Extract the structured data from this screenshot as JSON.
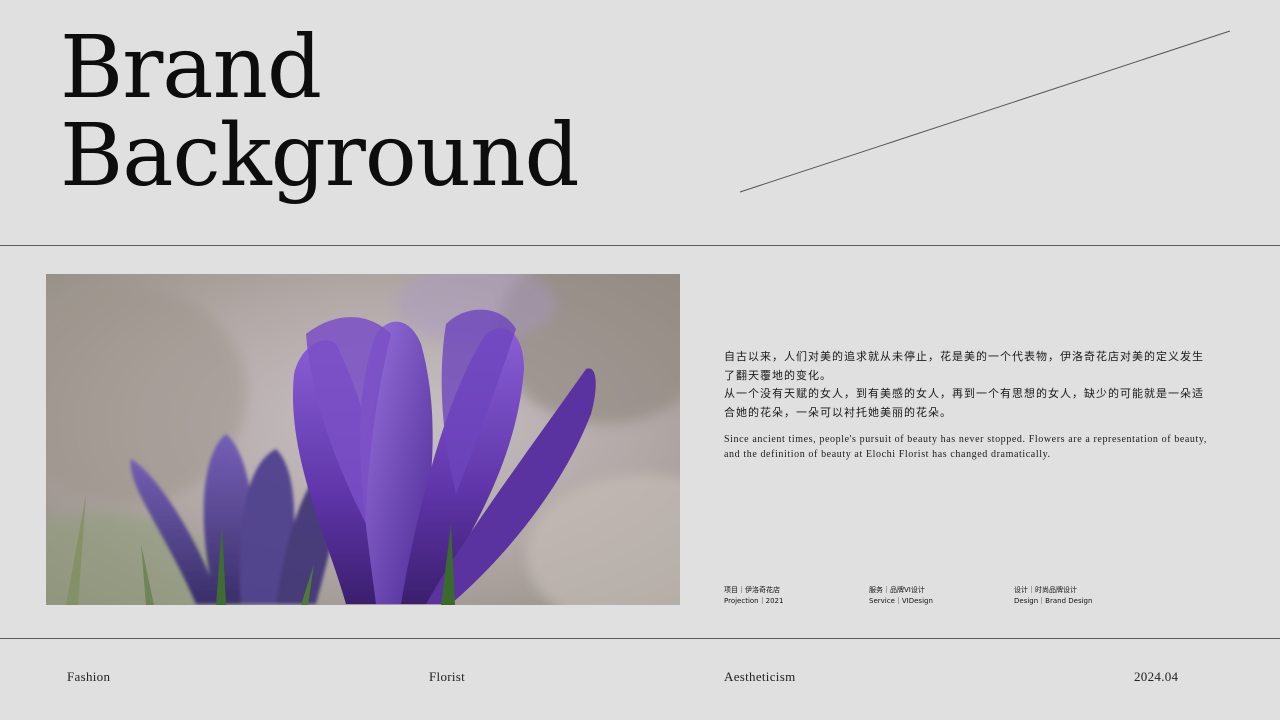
{
  "title": {
    "line1": "Brand",
    "line2": "Background"
  },
  "description": {
    "cn_para1": "自古以来，人们对美的追求就从未停止，花是美的一个代表物，伊洛奇花店对美的定义发生了翻天覆地的变化。",
    "cn_para2": "从一个没有天赋的女人，到有美感的女人，再到一个有思想的女人，缺少的可能就是一朵适合她的花朵，一朵可以衬托她美丽的花朵。",
    "en": "Since ancient times, people's pursuit of beauty has never stopped. Flowers are a representation of beauty, and the definition of beauty at Elochi Florist has changed dramatically."
  },
  "meta": [
    {
      "cn": "项目｜伊洛奇花店",
      "en": "Projection｜2021"
    },
    {
      "cn": "服务｜品牌VI设计",
      "en": "Service｜VIDesign"
    },
    {
      "cn": "设计｜时尚品牌设计",
      "en": "Design｜Brand Design"
    }
  ],
  "footer": {
    "item1": "Fashion",
    "item2": "Florist",
    "item3": "Aestheticism",
    "item4": "2024.04"
  },
  "colors": {
    "background": "#e0e0e0",
    "text": "#111111",
    "rule": "#5c5c5c",
    "flower_purple": "#6a3fb5"
  },
  "image": {
    "subject_icon": "crocus-photo"
  }
}
